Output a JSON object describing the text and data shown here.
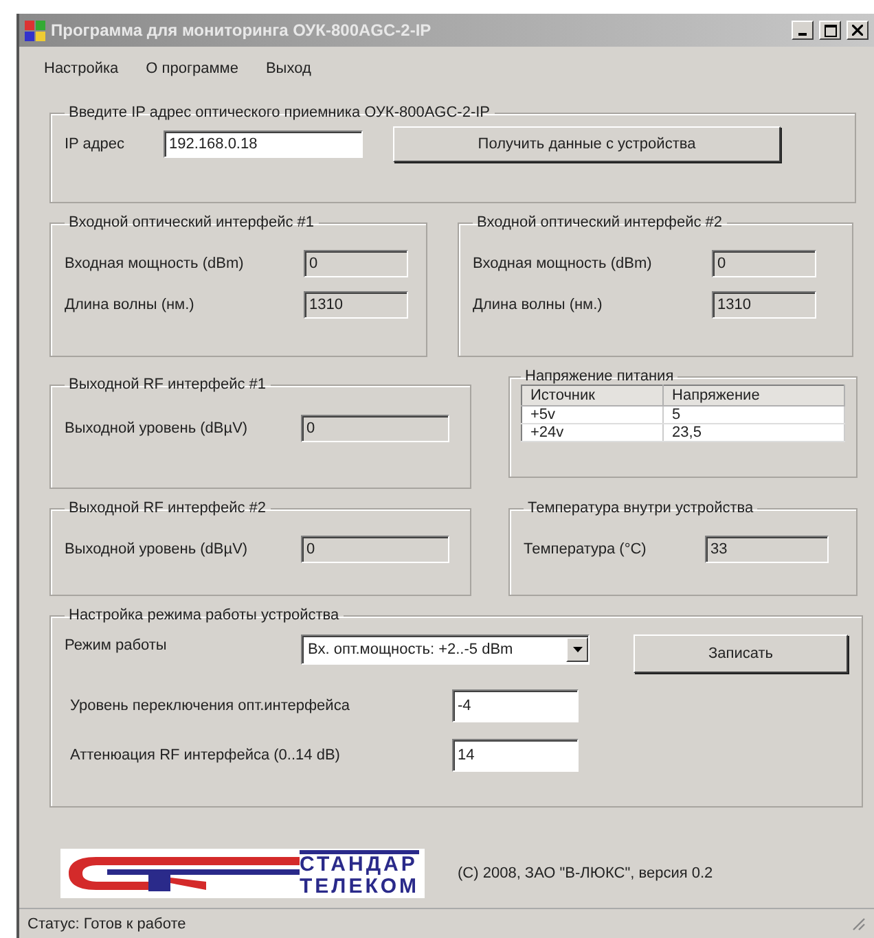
{
  "window": {
    "title": "Программа для мониторинга ОУК-800AGC-2-IP"
  },
  "menu": [
    "Настройка",
    "О программе",
    "Выход"
  ],
  "ip_group": {
    "legend": "Введите IP адрес оптического приемника ОУК-800AGC-2-IP",
    "label": "IP адрес",
    "value": "192.168.0.18",
    "button": "Получить данные с устройства"
  },
  "optical_inputs": [
    {
      "legend": "Входной оптический интерфейс #1",
      "fields": [
        {
          "label": "Входная мощность (dBm)",
          "value": "0"
        },
        {
          "label": "Длина волны (нм.)",
          "value": "1310"
        }
      ]
    },
    {
      "legend": "Входной оптический интерфейс #2",
      "fields": [
        {
          "label": "Входная мощность (dBm)",
          "value": "0"
        },
        {
          "label": "Длина волны (нм.)",
          "value": "1310"
        }
      ]
    }
  ],
  "rf_outputs": [
    {
      "legend": "Выходной RF интерфейс #1",
      "label": "Выходной уровень (dBµV)",
      "value": "0"
    },
    {
      "legend": "Выходной RF интерфейс #2",
      "label": "Выходной уровень (dBµV)",
      "value": "0"
    }
  ],
  "power": {
    "legend": "Напряжение питания",
    "columns": [
      "Источник",
      "Напряжение"
    ],
    "rows": [
      [
        "+5v",
        "5"
      ],
      [
        "+24v",
        "23,5"
      ]
    ]
  },
  "temperature": {
    "legend": "Температура внутри устройства",
    "label": "Температура (°C)",
    "value": "33"
  },
  "settings": {
    "legend": "Настройка режима работы устройства",
    "mode_label": "Режим работы",
    "mode_value": "Вх. опт.мощность: +2..-5 dBm",
    "button": "Записать",
    "fields": [
      {
        "label": "Уровень переключения опт.интерфейса",
        "value": "-4"
      },
      {
        "label": "Аттенюация RF интерфейса (0..14 dB)",
        "value": "14"
      }
    ]
  },
  "logo": {
    "line1": "СТАНДАР",
    "line2": "ТЕЛЕКОМ"
  },
  "copyright": "(C) 2008, ЗАО \"В-ЛЮКС\", версия 0.2",
  "status": "Статус: Готов к работе"
}
